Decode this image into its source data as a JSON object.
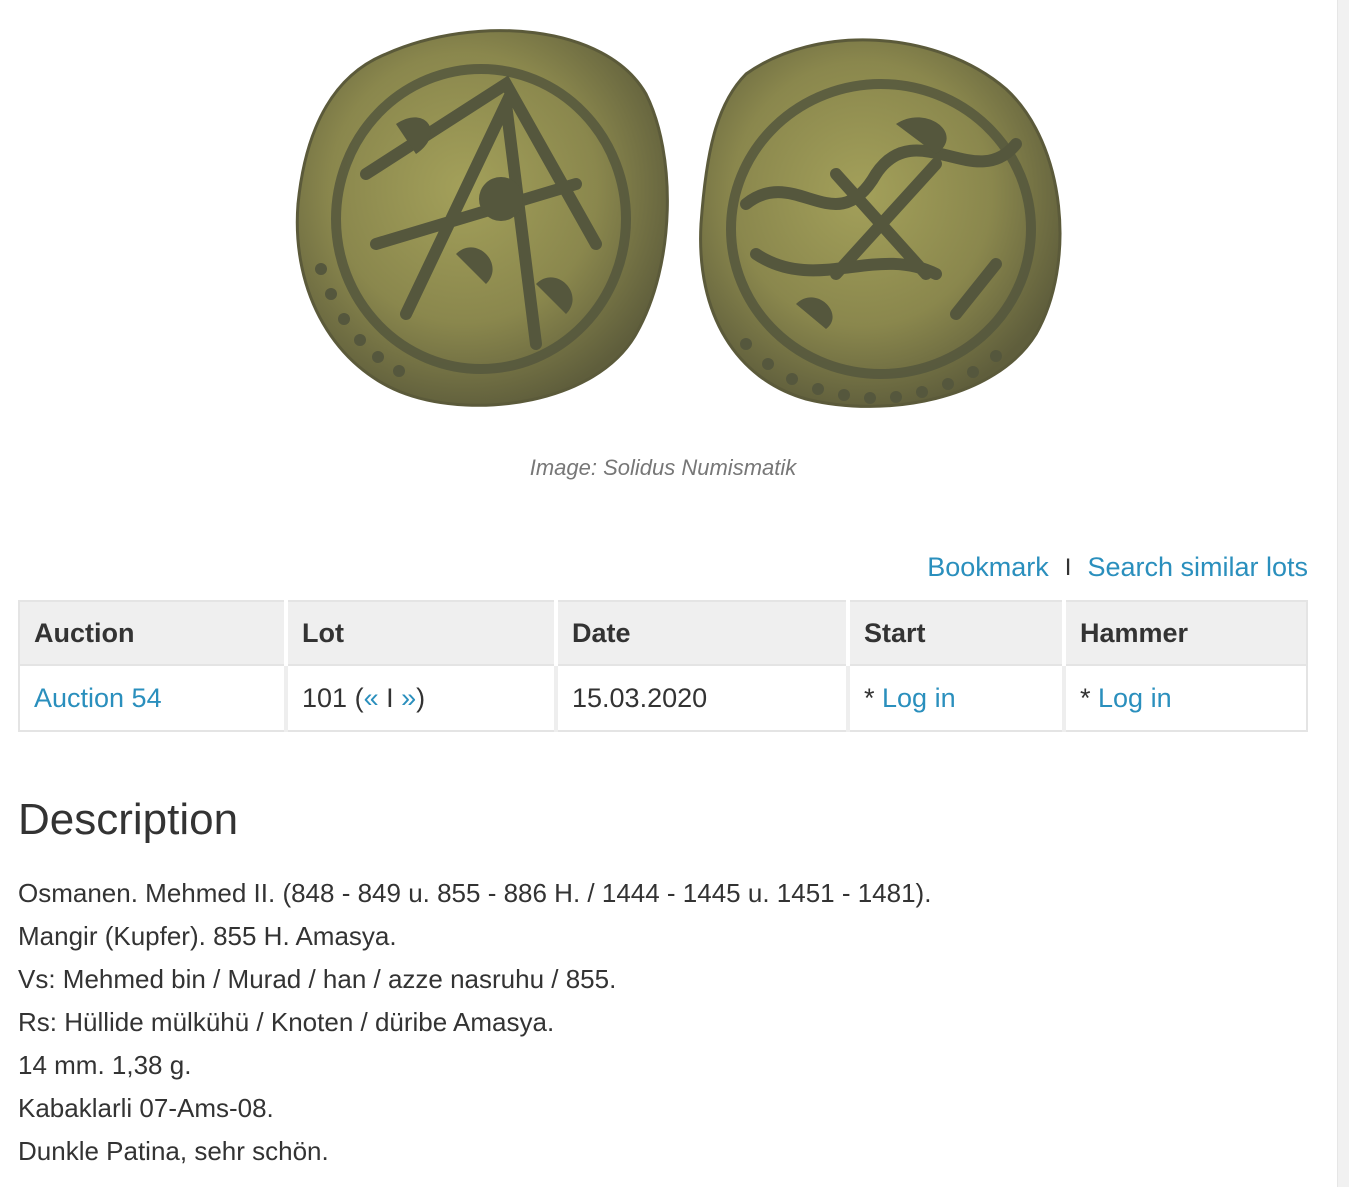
{
  "image_caption": "Image: Solidus Numismatik",
  "actions": {
    "bookmark_label": "Bookmark",
    "separator": "I",
    "search_similar_label": "Search similar lots"
  },
  "table": {
    "headers": [
      "Auction",
      "Lot",
      "Date",
      "Start",
      "Hammer"
    ],
    "row": {
      "auction": "Auction 54",
      "lot_number": "101",
      "lot_prev": "«",
      "lot_sep": "I",
      "lot_next": "»",
      "date": "15.03.2020",
      "start_prefix": "* ",
      "start_link": "Log in",
      "hammer_prefix": "* ",
      "hammer_link": "Log in"
    }
  },
  "description": {
    "title": "Description",
    "lines": [
      "Osmanen. Mehmed II. (848 - 849 u. 855 - 886 H. / 1444 - 1445 u. 1451 - 1481).",
      "Mangir (Kupfer). 855 H. Amasya.",
      "Vs: Mehmed bin / Murad / han / azze nasruhu / 855.",
      "Rs: Hüllide mülkühü / Knoten / düribe Amasya.",
      "14 mm. 1,38 g.",
      "Kabaklarli 07-Ams-08.",
      "Dunkle Patina, sehr schön."
    ]
  },
  "colors": {
    "link": "#2a8fbd",
    "text": "#333333",
    "caption": "#777777",
    "header_bg": "#efefef",
    "coin_face": "#8c8a4e",
    "coin_relief": "#55573d"
  }
}
